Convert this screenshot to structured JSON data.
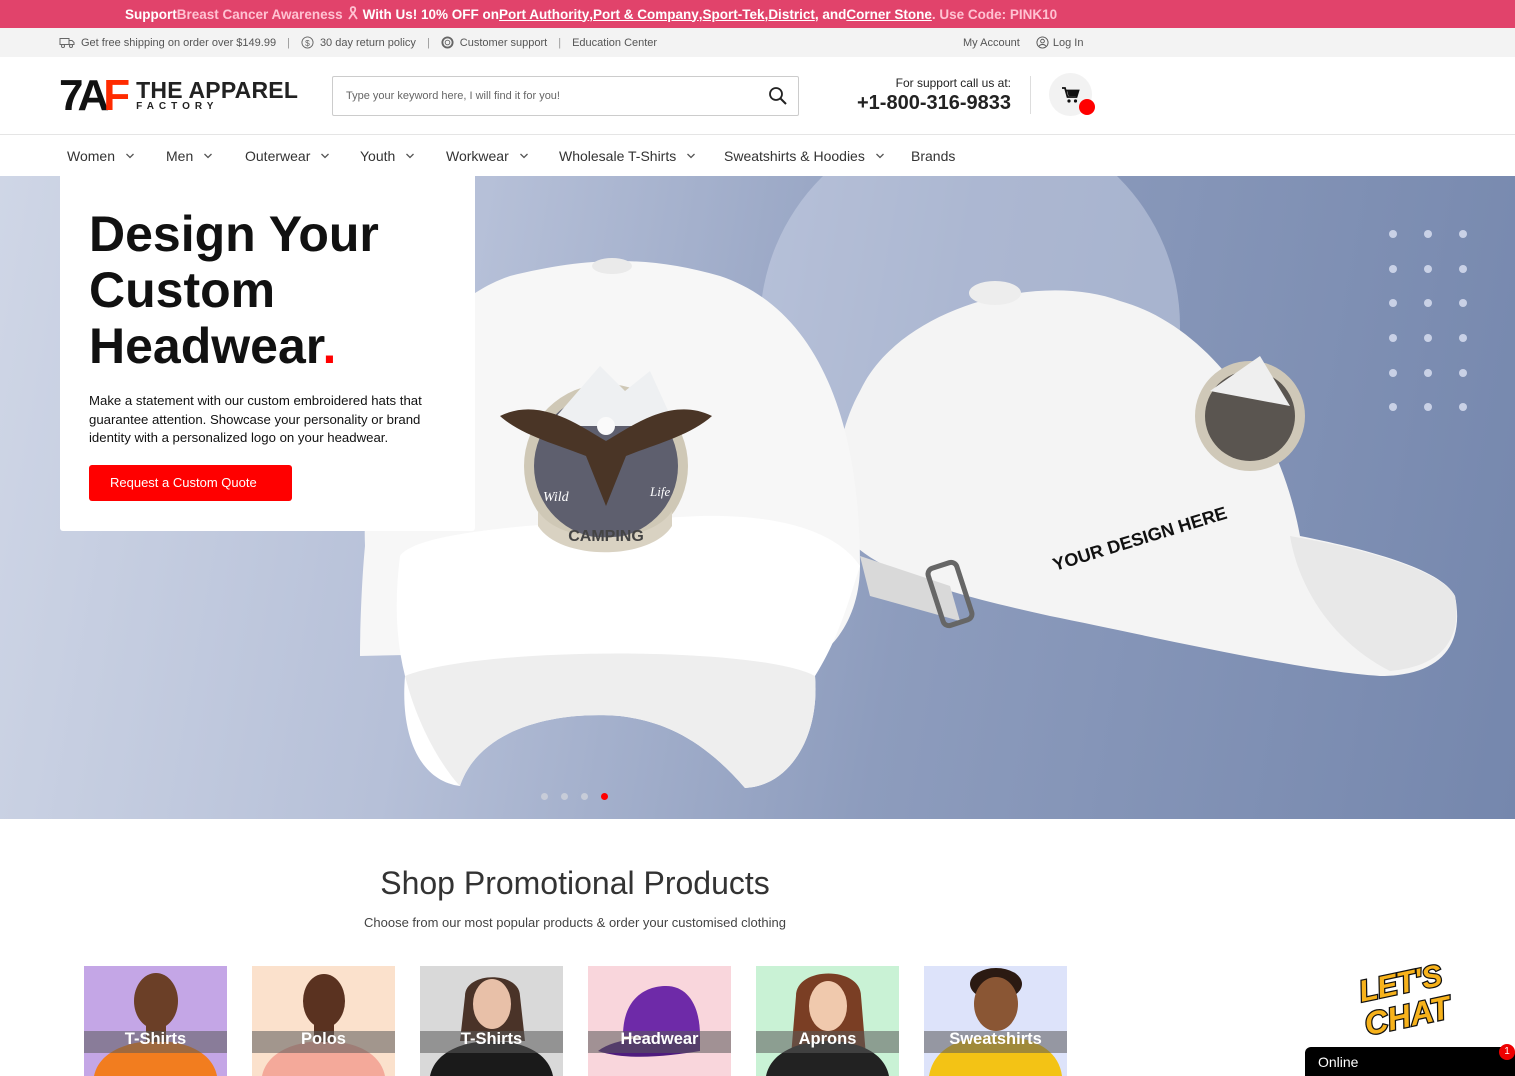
{
  "promo": {
    "p1": "Support ",
    "p2": "Breast Cancer Awareness",
    "p3": " With Us! 10% OFF on ",
    "brand1": "Port Authority",
    "comma1": ", ",
    "brand2": "Port & Company",
    "comma2": ", ",
    "brand3": "Sport-Tek",
    "comma3": ", ",
    "brand4": "District",
    "and": ", and ",
    "brand5": "Corner Stone",
    "code": ". Use Code: PINK10"
  },
  "util": {
    "shipping": "Get free shipping on order over $149.99",
    "returns": "30 day return policy",
    "support": "Customer support",
    "education": "Education Center",
    "account": "My Account",
    "login": "Log In"
  },
  "header": {
    "logo_mark_1": "7A",
    "logo_mark_2": "F",
    "logo_line1": "THE APPAREL",
    "logo_line2": "FACTORY",
    "search_placeholder": "Type your keyword here, I will find it for you!",
    "support_label": "For support call us at:",
    "phone": "+1-800-316-9833"
  },
  "nav": [
    {
      "label": "Women"
    },
    {
      "label": "Men"
    },
    {
      "label": "Outerwear"
    },
    {
      "label": "Youth"
    },
    {
      "label": "Workwear"
    },
    {
      "label": "Wholesale T-Shirts"
    },
    {
      "label": "Sweatshirts & Hoodies"
    },
    {
      "label": "Brands"
    }
  ],
  "hero": {
    "title_l1": "Design Your",
    "title_l2": "Custom",
    "title_l3": "Headwear",
    "title_dot": ".",
    "text": "Make a statement with our custom embroidered hats that guarantee attention. Showcase your personality or brand identity with a personalized logo on your headwear.",
    "cta": "Request a Custom Quote",
    "logo_word1": "Wild",
    "logo_word2": "Life",
    "logo_word3": "CAMPING",
    "cap_text": "YOUR DESIGN HERE",
    "slide_count": 4,
    "active_slide": 4
  },
  "products": {
    "title": "Shop Promotional Products",
    "subtitle": "Choose from our most popular products & order your customised clothing",
    "items": [
      {
        "label": "T-Shirts",
        "bg": "#c4a6e6"
      },
      {
        "label": "Polos",
        "bg": "#fbe1cc"
      },
      {
        "label": "T-Shirts",
        "bg": "#d9d9d9"
      },
      {
        "label": "Headwear",
        "bg": "#f9d6dc"
      },
      {
        "label": "Aprons",
        "bg": "#c9f2d5"
      },
      {
        "label": "Sweatshirts",
        "bg": "#dde3fa"
      }
    ]
  },
  "chat": {
    "logo_l1": "LET'S",
    "logo_l2": "CHAT",
    "status": "Online",
    "badge": "1"
  },
  "colors": {
    "promo_bg": "#e1436b",
    "accent": "#ff0000"
  }
}
